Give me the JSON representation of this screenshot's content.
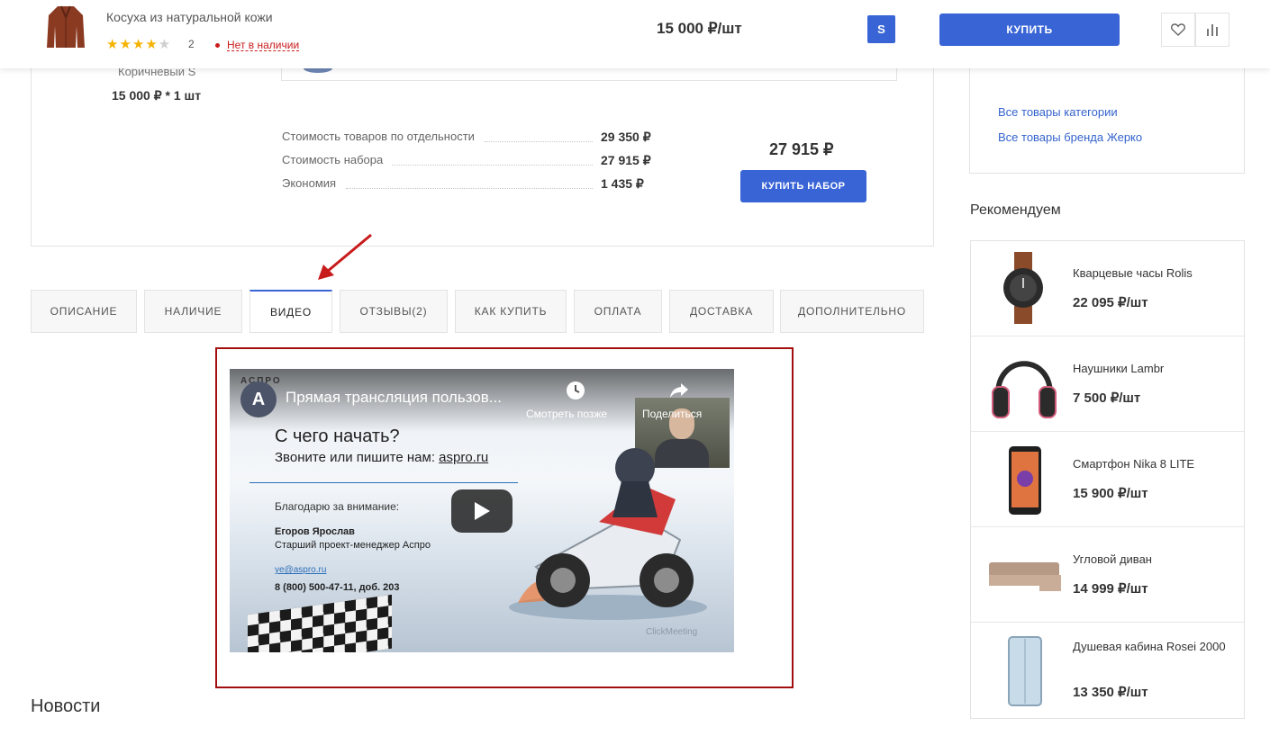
{
  "header": {
    "product_title": "Косуха из натуральной кожи",
    "stars_on": "★★★★",
    "stars_off": "★",
    "reviews_count": "2",
    "stock_status": "Нет в наличии",
    "price": "15 000 ₽/шт",
    "size": "S",
    "buy_label": "КУПИТЬ"
  },
  "set": {
    "color_size": "Коричневый S",
    "qty_line": "15 000 ₽ * 1 шт",
    "rows": [
      {
        "label": "Стоимость товаров по отдельности",
        "value": "29 350 ₽"
      },
      {
        "label": "Стоимость набора",
        "value": "27 915 ₽"
      },
      {
        "label": "Экономия",
        "value": "1 435 ₽"
      }
    ],
    "total": "27 915 ₽",
    "buy_set_label": "КУПИТЬ НАБОР"
  },
  "side": {
    "links": [
      "Все товары категории",
      "Все товары бренда Жерко"
    ],
    "recommend_title": "Рекомендуем"
  },
  "tabs": [
    {
      "label": "ОПИСАНИЕ"
    },
    {
      "label": "НАЛИЧИЕ"
    },
    {
      "label": "ВИДЕО"
    },
    {
      "label": "ОТЗЫВЫ(2)"
    },
    {
      "label": "КАК КУПИТЬ"
    },
    {
      "label": "ОПЛАТА"
    },
    {
      "label": "ДОСТАВКА"
    },
    {
      "label": "ДОПОЛНИТЕЛЬНО"
    }
  ],
  "video": {
    "channel_avatar": "A",
    "title": "Прямая трансляция пользов...",
    "watch_later": "Смотреть позже",
    "share": "Поделиться",
    "brand": "АСПРО",
    "heading": "С чего начать?",
    "subheading_prefix": "Звоните или пишите нам: ",
    "subheading_link": "aspro.ru",
    "thanks": "Благодарю за внимание:",
    "person_name": "Егоров Ярослав",
    "person_role": "Старший проект-менеджер Аспро",
    "email": "ye@aspro.ru",
    "phone": "8 (800) 500-47-11, доб. 203",
    "watermark": "ClickMeeting"
  },
  "news_title": "Новости",
  "recommendations": [
    {
      "name": "Кварцевые часы Rolis",
      "price": "22 095 ₽/шт",
      "icon": "watch-icon"
    },
    {
      "name": "Наушники Lambr",
      "price": "7 500 ₽/шт",
      "icon": "headphones-icon"
    },
    {
      "name": "Смартфон Nika 8 LITE",
      "price": "15 900 ₽/шт",
      "icon": "smartphone-icon"
    },
    {
      "name": "Угловой диван",
      "price": "14 999 ₽/шт",
      "icon": "sofa-icon"
    },
    {
      "name": "Душевая кабина Rosei 2000",
      "price": "13 350 ₽/шт",
      "icon": "shower-cabin-icon"
    }
  ],
  "colors": {
    "accent": "#3964d6",
    "link": "#3463cc",
    "out_of_stock": "#c81b1b",
    "highlight_frame": "#a30f0f",
    "star": "#f5b301"
  }
}
